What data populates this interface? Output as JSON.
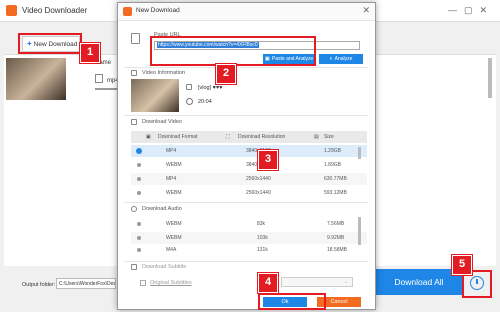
{
  "main_window": {
    "title": "Video Downloader",
    "new_download_label": "New Download",
    "name_label": "Name",
    "format_text": "mp4",
    "output_folder_label": "Output folder:",
    "output_folder_path": "C:\\Users\\WonderFox\\Deskt",
    "download_all_label": "Download All"
  },
  "dialog": {
    "title": "New Download",
    "paste_url_label": "Paste URL",
    "url_value": "https://www.youtube.com/watch?v=4XFlBsc0",
    "paste_analyze_label": "Paste and Analyze",
    "analyze_label": "Analyze",
    "video_info_label": "Video Information",
    "video_title": "[vlog] ♥♥♥",
    "video_duration": "20:04",
    "download_video_label": "Download Video",
    "video_columns": [
      "Download Format",
      "Download Resolution",
      "Size"
    ],
    "video_rows": [
      {
        "format": "MP4",
        "resolution": "3840x2160",
        "size": "1.29GB"
      },
      {
        "format": "WEBM",
        "resolution": "3840x2160",
        "size": "1.89GB"
      },
      {
        "format": "MP4",
        "resolution": "2560x1440",
        "size": "630.77MB"
      },
      {
        "format": "WEBM",
        "resolution": "2560x1440",
        "size": "593.12MB"
      }
    ],
    "download_audio_label": "Download Audio",
    "audio_rows": [
      {
        "format": "WEBM",
        "bitrate": "83k",
        "size": "7.56MB"
      },
      {
        "format": "WEBM",
        "bitrate": "103k",
        "size": "9.92MB"
      },
      {
        "format": "M4A",
        "bitrate": "131k",
        "size": "18.58MB"
      }
    ],
    "download_subtitle_label": "Download Subtitle",
    "original_subtitles_label": "Original Subtitles",
    "subtitle_select_value": "",
    "ok_label": "Ok",
    "cancel_label": "Cancel"
  },
  "callouts": [
    "1",
    "2",
    "3",
    "4",
    "5"
  ],
  "colors": {
    "accent_blue": "#1e86e6",
    "brand_orange": "#f26b21",
    "callout_red": "#e31b23"
  }
}
